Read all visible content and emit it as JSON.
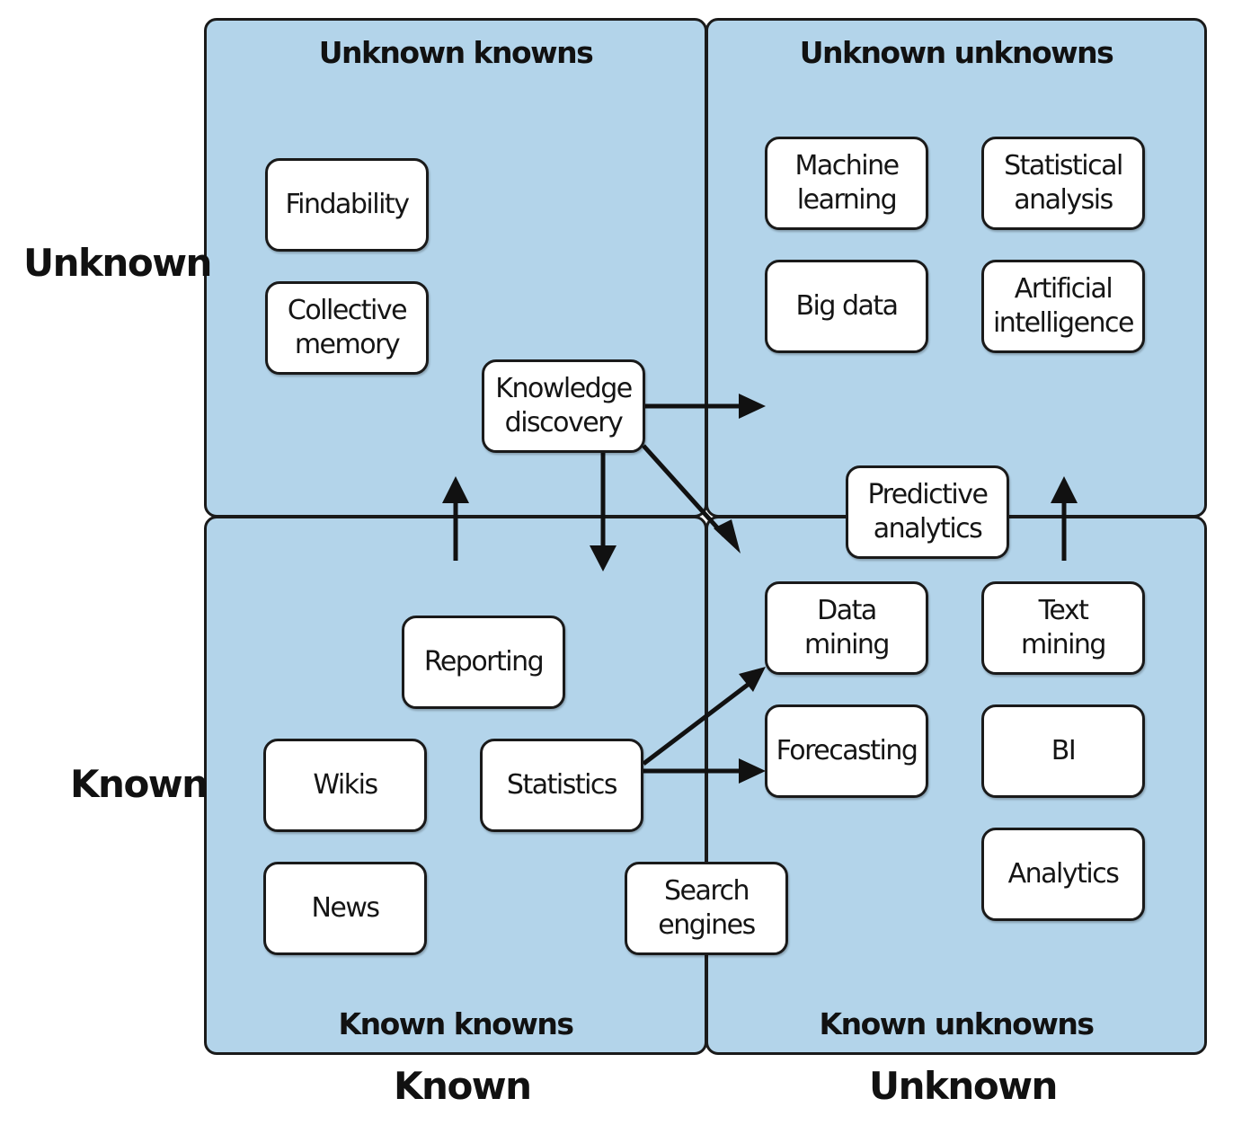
{
  "axes": {
    "y_top": "Unknown",
    "y_bottom": "Known",
    "x_left": "Known",
    "x_right": "Unknown"
  },
  "quadrants": {
    "top_left": "Unknown knowns",
    "top_right": "Unknown unknowns",
    "bottom_left": "Known knowns",
    "bottom_right": "Known unknowns"
  },
  "nodes": {
    "findability": "Findability",
    "collective_memory": "Collective\nmemory",
    "knowledge_discovery": "Knowledge\ndiscovery",
    "machine_learning": "Machine\nlearning",
    "statistical_analysis": "Statistical\nanalysis",
    "big_data": "Big data",
    "artificial_intelligence": "Artificial\nintelligence",
    "predictive_analytics": "Predictive\nanalytics",
    "reporting": "Reporting",
    "wikis": "Wikis",
    "statistics": "Statistics",
    "news": "News",
    "search_engines": "Search\nengines",
    "data_mining": "Data\nmining",
    "text_mining": "Text\nmining",
    "forecasting": "Forecasting",
    "bi": "BI",
    "analytics": "Analytics"
  },
  "arrows": [
    {
      "from": "Knowledge discovery",
      "to": "Unknown unknowns",
      "direction": "right"
    },
    {
      "from": "Knowledge discovery",
      "to": "Known knowns",
      "direction": "down"
    },
    {
      "from": "Knowledge discovery",
      "to": "Known unknowns",
      "direction": "down-right"
    },
    {
      "from": "Known knowns",
      "to": "Unknown knowns",
      "direction": "up"
    },
    {
      "from": "Known unknowns",
      "to": "Unknown unknowns",
      "direction": "up"
    },
    {
      "from": "Statistics",
      "to": "Data mining",
      "direction": "up-right"
    },
    {
      "from": "Statistics",
      "to": "Forecasting",
      "direction": "right"
    }
  ]
}
